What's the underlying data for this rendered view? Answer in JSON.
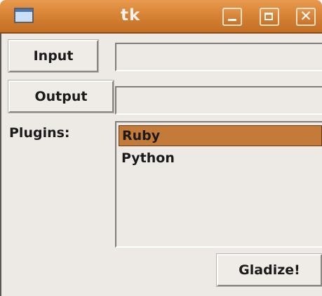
{
  "window": {
    "title": "tk",
    "controls": {
      "minimize_icon": "minimize-icon",
      "maximize_icon": "maximize-icon",
      "close_icon": "close-icon",
      "close_glyph": "✕"
    },
    "title_bar_color": "#d88436"
  },
  "form": {
    "input_button_label": "Input",
    "input_field_value": "",
    "output_button_label": "Output",
    "output_field_value": "",
    "plugins_label": "Plugins:",
    "plugins": [
      {
        "label": "Ruby",
        "selected": true
      },
      {
        "label": "Python",
        "selected": false
      }
    ],
    "gladize_button_label": "Gladize!"
  },
  "colors": {
    "selection": "#c47b3a",
    "background": "#edeae5"
  }
}
